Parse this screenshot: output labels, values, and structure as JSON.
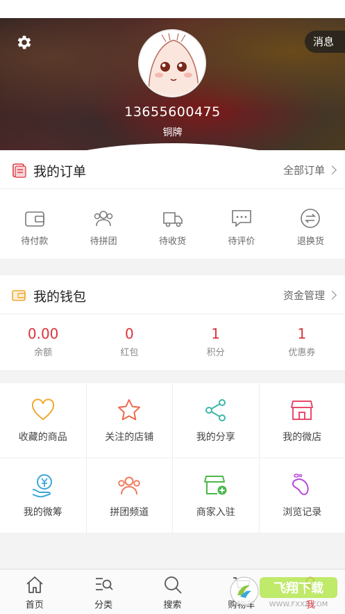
{
  "profile": {
    "phone": "13655600475",
    "level": "铜牌",
    "message_label": "消息"
  },
  "orders": {
    "title": "我的订单",
    "more": "全部订单",
    "items": [
      {
        "label": "待付款",
        "icon": "wallet-icon"
      },
      {
        "label": "待拼团",
        "icon": "group-icon"
      },
      {
        "label": "待收货",
        "icon": "truck-icon"
      },
      {
        "label": "待评价",
        "icon": "comment-icon"
      },
      {
        "label": "退换货",
        "icon": "return-icon"
      }
    ]
  },
  "wallet": {
    "title": "我的钱包",
    "more": "资金管理",
    "items": [
      {
        "value": "0.00",
        "label": "余额"
      },
      {
        "value": "0",
        "label": "红包"
      },
      {
        "value": "1",
        "label": "积分"
      },
      {
        "value": "1",
        "label": "优惠券"
      }
    ]
  },
  "services": [
    {
      "label": "收藏的商品",
      "icon": "heart-icon",
      "color": "#f0a830"
    },
    {
      "label": "关注的店铺",
      "icon": "star-icon",
      "color": "#ee6a4a"
    },
    {
      "label": "我的分享",
      "icon": "share-icon",
      "color": "#3bb8a8"
    },
    {
      "label": "我的微店",
      "icon": "shop-icon",
      "color": "#e84a6a"
    },
    {
      "label": "我的微筹",
      "icon": "crowdfund-icon",
      "color": "#3aa8d8"
    },
    {
      "label": "拼团频道",
      "icon": "group-channel-icon",
      "color": "#ee7a5a"
    },
    {
      "label": "商家入驻",
      "icon": "merchant-icon",
      "color": "#4cb84c"
    },
    {
      "label": "浏览记录",
      "icon": "footprint-icon",
      "color": "#b84ad8"
    }
  ],
  "tabs": [
    {
      "label": "首页",
      "icon": "home-icon"
    },
    {
      "label": "分类",
      "icon": "category-icon"
    },
    {
      "label": "搜索",
      "icon": "search-icon"
    },
    {
      "label": "购物车",
      "icon": "cart-icon"
    },
    {
      "label": "我",
      "icon": "profile-icon"
    }
  ],
  "colors": {
    "accent": "#d9343d",
    "active_tab": "#e3303a"
  }
}
